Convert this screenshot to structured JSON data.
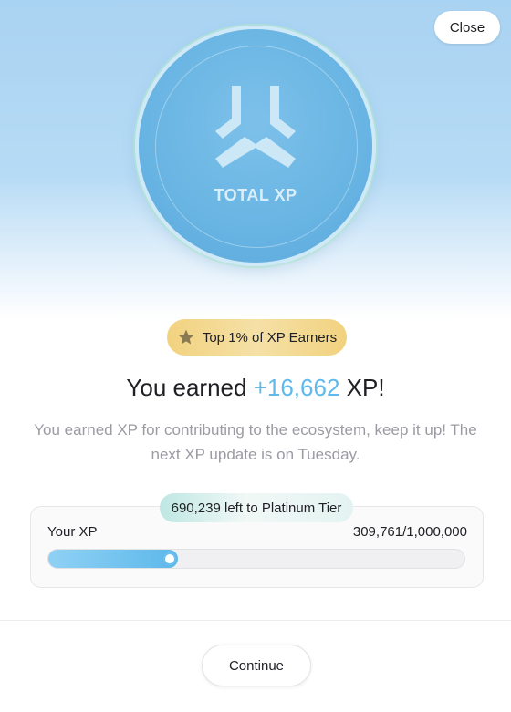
{
  "header": {
    "close_label": "Close"
  },
  "coin": {
    "label": "TOTAL XP",
    "icon": "xp-logo-icon"
  },
  "badge": {
    "icon": "star-icon",
    "label": "Top 1% of XP Earners"
  },
  "headline": {
    "prefix": "You earned",
    "amount": "+16,662",
    "suffix": "XP!"
  },
  "description": "You earned XP for contributing to the ecosystem, keep it up! The next XP update is on Tuesday.",
  "progress": {
    "remaining_label": "690,239 left to Platinum Tier",
    "label": "Your XP",
    "value_text": "309,761/1,000,000",
    "current": 309761,
    "max": 1000000
  },
  "footer": {
    "continue_label": "Continue"
  },
  "colors": {
    "accent": "#5fb9ec",
    "badge_gold": "#f1d27f",
    "muted_text": "#9b9ba3"
  }
}
